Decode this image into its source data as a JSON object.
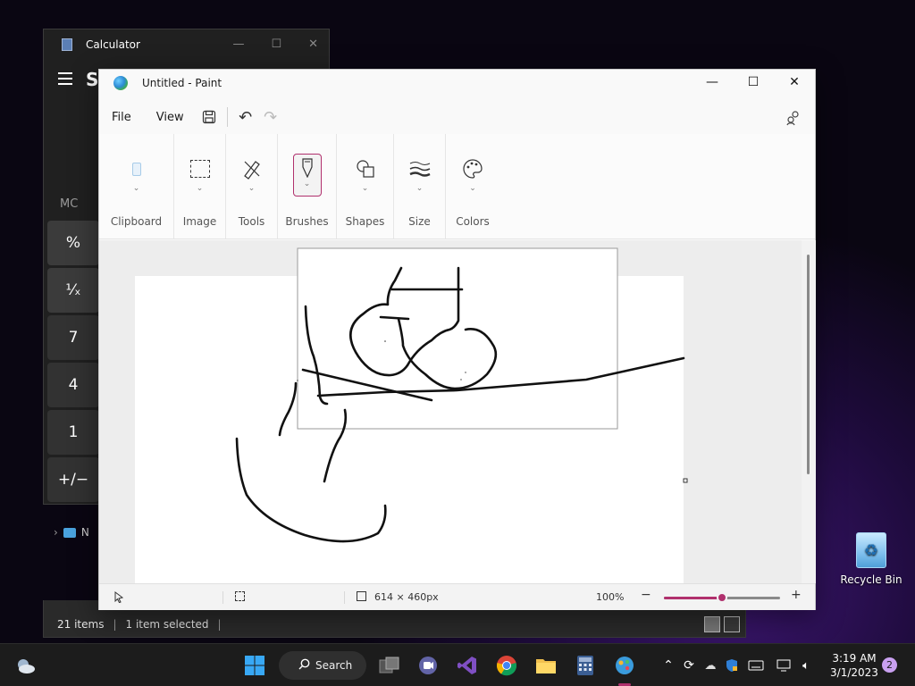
{
  "calculator": {
    "title": "Calculator",
    "mode": "St",
    "memory_label": "MC",
    "keys": [
      "%",
      "¹⁄ₓ",
      "7",
      "4",
      "1",
      "+/−"
    ]
  },
  "explorer": {
    "nav_item": "N",
    "status_items": "21 items",
    "status_selected": "1 item selected",
    "separator": "|"
  },
  "paint": {
    "title": "Untitled - Paint",
    "menu": {
      "file": "File",
      "view": "View"
    },
    "ribbon": {
      "clipboard": "Clipboard",
      "image": "Image",
      "tools": "Tools",
      "brushes": "Brushes",
      "shapes": "Shapes",
      "size": "Size",
      "colors": "Colors"
    },
    "status": {
      "canvas_size": "614 × 460px",
      "zoom": "100%",
      "zoom_level": 0.5
    }
  },
  "desktop": {
    "recycle_bin": "Recycle Bin"
  },
  "taskbar": {
    "search_label": "Search",
    "time": "3:19 AM",
    "date": "3/1/2023",
    "notification_count": "2"
  },
  "colors": {
    "accent": "#b0306d",
    "taskbar_bg": "#1c1c1c",
    "paint_bg": "#f9f9f9"
  }
}
